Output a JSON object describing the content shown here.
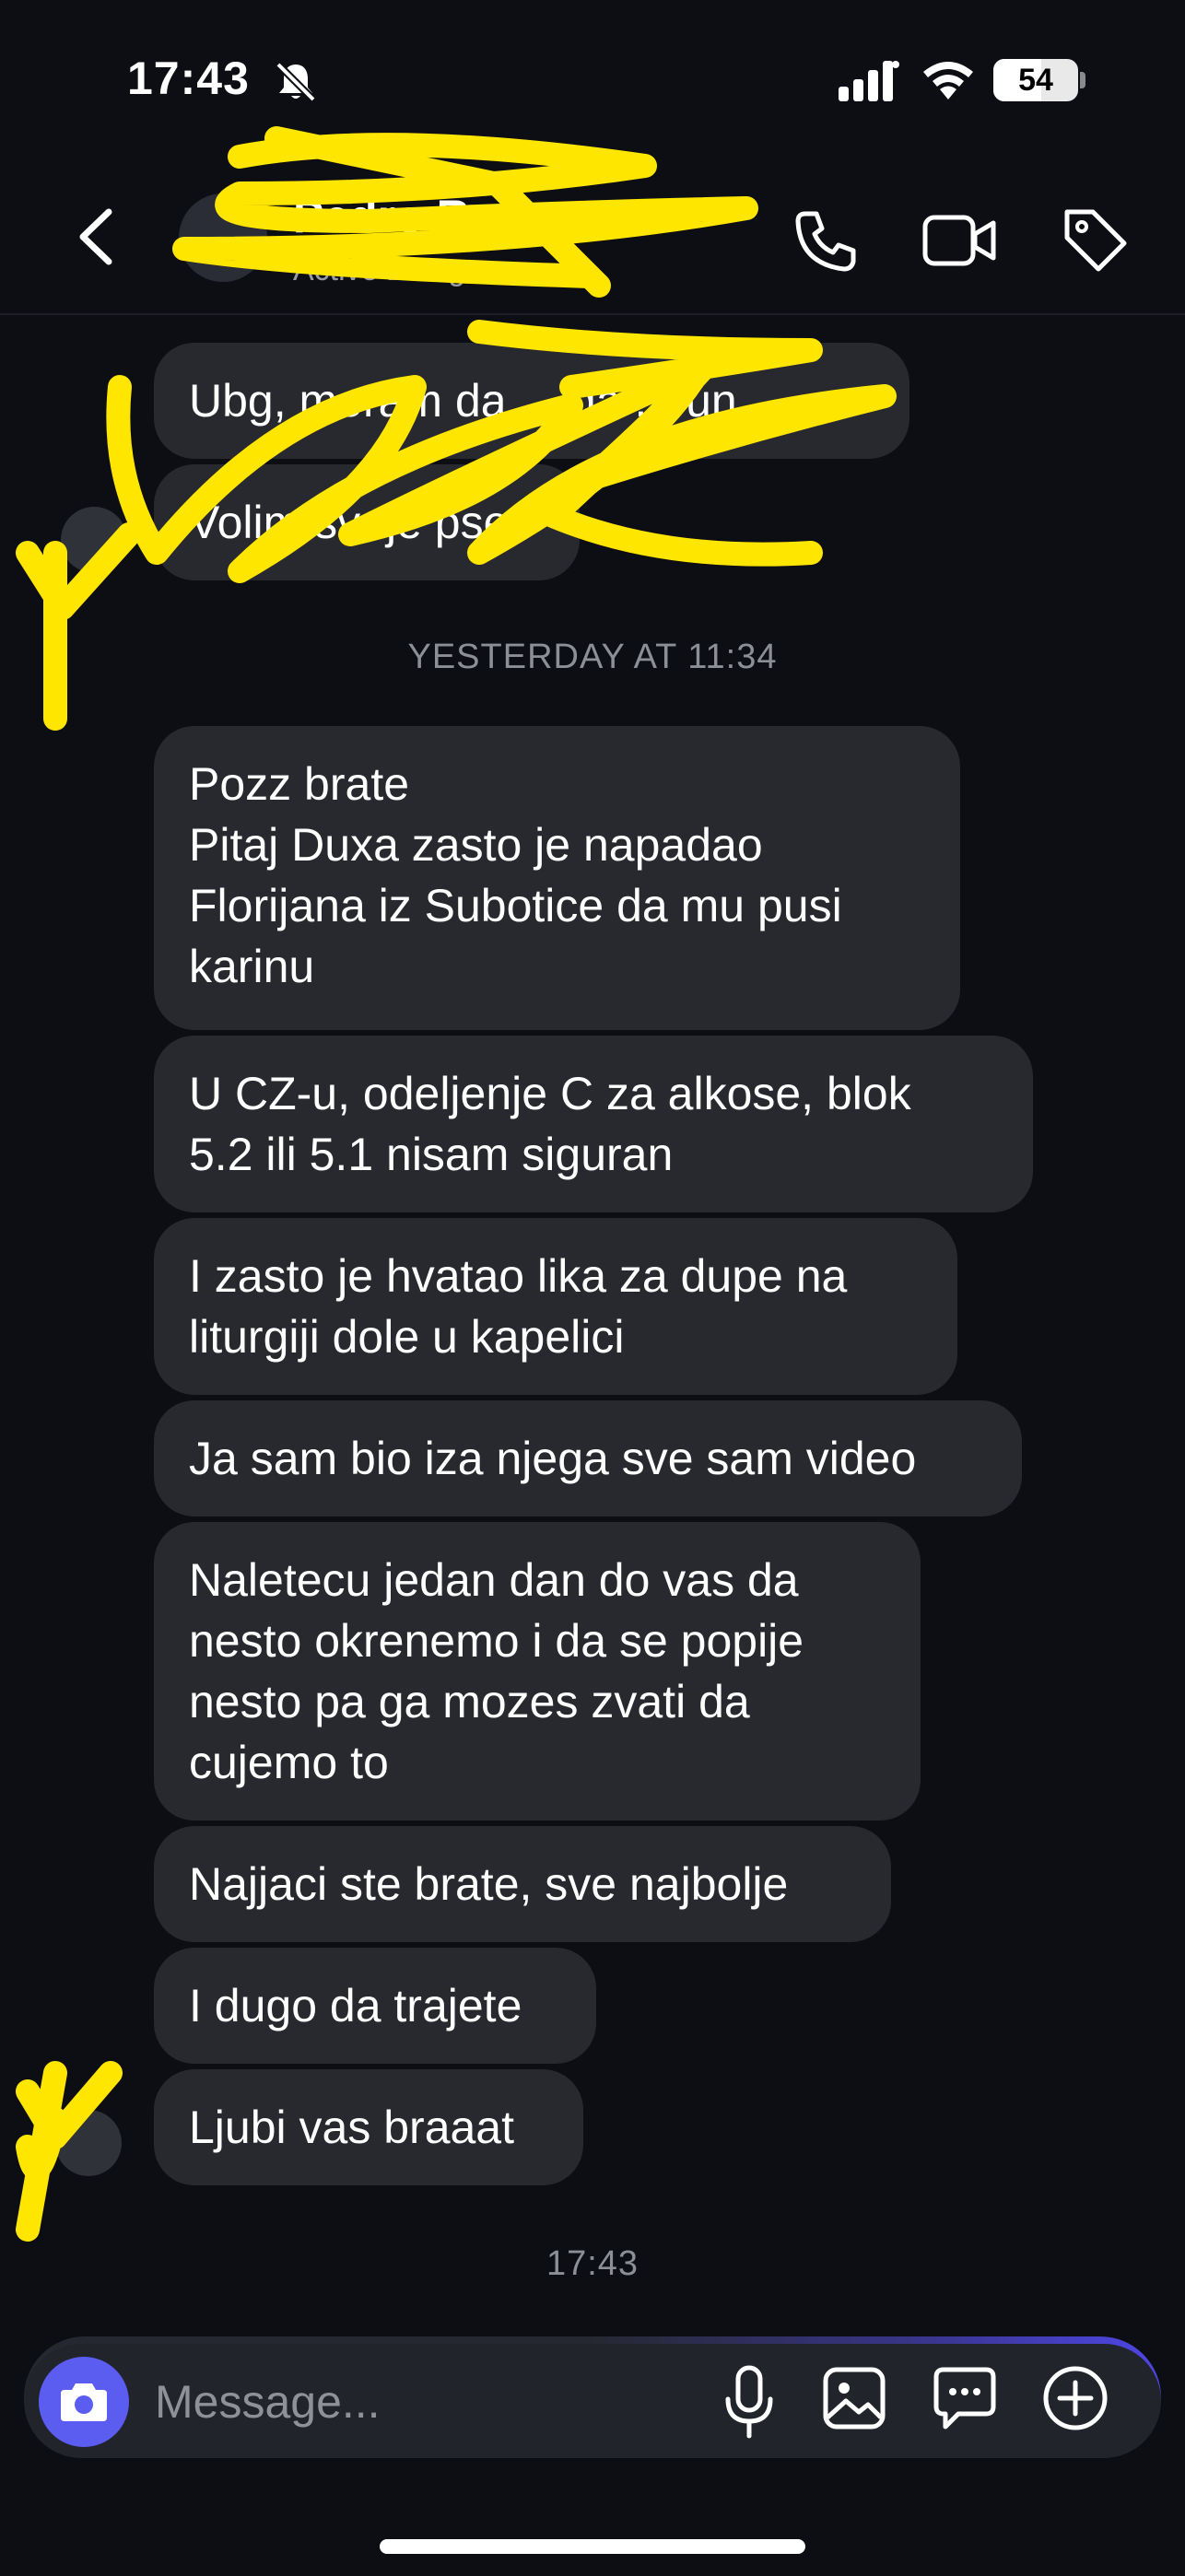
{
  "status_bar": {
    "time": "17:43",
    "battery_level": "54",
    "icons": [
      "bell-slash-icon",
      "signal-icon",
      "wifi-icon",
      "battery-icon"
    ]
  },
  "header": {
    "contact_name": "Pedro Ro...",
    "contact_status": "Active 2h ago",
    "icons": [
      "back-icon",
      "phone-icon",
      "video-icon",
      "tag-icon"
    ]
  },
  "messages_early": [
    {
      "text": "Ubg, moram da ... da ... un"
    },
    {
      "text": "Volim svoje pse"
    }
  ],
  "divider_yesterday": "YESTERDAY AT 11:34",
  "messages": [
    {
      "lines": [
        "Pozz brate",
        "Pitaj Duxa zasto je napadao",
        "Florijana iz Subotice da mu pusi",
        "karinu"
      ]
    },
    {
      "lines": [
        "U CZ-u, odeljenje C za alkose, blok",
        "5.2 ili 5.1 nisam siguran"
      ]
    },
    {
      "lines": [
        "I zasto je hvatao lika za dupe na",
        "liturgiji dole u kapelici"
      ]
    },
    {
      "lines": [
        "Ja sam bio iza njega sve sam video"
      ]
    },
    {
      "lines": [
        "Naletecu jedan dan do vas da",
        "nesto okrenemo i da se popije",
        "nesto pa ga mozes zvati da",
        "cujemo to"
      ]
    },
    {
      "lines": [
        "Najjaci ste brate, sve najbolje"
      ]
    },
    {
      "lines": [
        "I dugo da trajete"
      ]
    },
    {
      "lines": [
        "Ljubi vas braaat"
      ]
    }
  ],
  "divider_now": "17:43",
  "composer": {
    "placeholder": "Message...",
    "icons": [
      "camera-icon",
      "mic-icon",
      "gallery-icon",
      "sticker-icon",
      "plus-icon"
    ]
  },
  "colors": {
    "background": "#0c0e14",
    "bubble": "#27292f",
    "accent": "#5b5cf0",
    "scribble": "#ffe600"
  }
}
